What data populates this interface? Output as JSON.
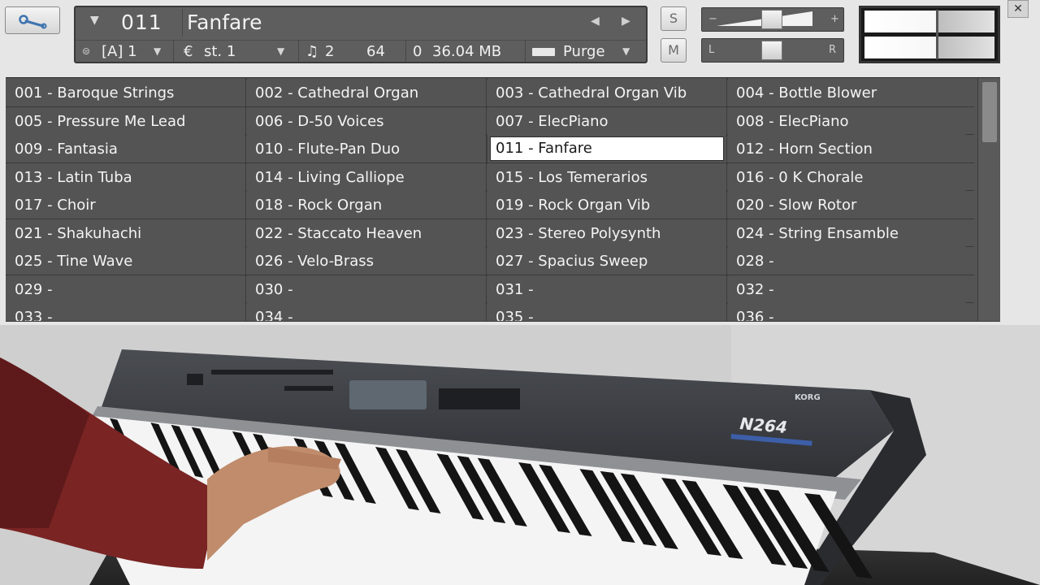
{
  "header": {
    "patch_number": "011",
    "patch_name": "Fanfare",
    "midi_channel": "[A] 1",
    "output": "st. 1",
    "voices": "2",
    "max_voices": "64",
    "memory": "36.04 MB",
    "purge_label": "Purge",
    "solo_label": "S",
    "mute_label": "M",
    "pan_left": "L",
    "pan_right": "R",
    "vol_minus": "−",
    "vol_plus": "+"
  },
  "presets": [
    "001 - Baroque Strings",
    "002 - Cathedral Organ",
    "003 - Cathedral Organ Vib",
    "004 - Bottle Blower",
    "005 - Pressure Me Lead",
    "006 - D-50 Voices",
    "007 - ElecPiano",
    "008 - ElecPiano",
    "009 - Fantasia",
    "010 - Flute-Pan Duo",
    "011 - Fanfare",
    "012 - Horn Section",
    "013 - Latin Tuba",
    "014 - Living Calliope",
    "015 - Los Temerarios",
    "016 - 0 K Chorale",
    "017 - Choir",
    "018 - Rock Organ",
    "019 - Rock Organ Vib",
    "020 - Slow Rotor",
    "021 - Shakuhachi",
    "022 - Staccato Heaven",
    "023 - Stereo Polysynth",
    "024 - String Ensamble",
    "025 - Tine Wave",
    "026 - Velo-Brass",
    "027 - Spacius Sweep",
    "028 -",
    "029 -",
    "030 -",
    "031 -",
    "032 -",
    "033 -",
    "034 -",
    "035 -",
    "036 -"
  ],
  "selected_preset": "011 - Fanfare",
  "photo": {
    "brand": "KORG",
    "model": "N264"
  },
  "icons": {
    "wrench": "wrench-icon",
    "midi": "midi-port-icon",
    "output": "output-icon",
    "voices": "voices-icon",
    "memory": "memory-icon",
    "close": "close-icon"
  },
  "colors": {
    "panel": "#5e5e5e",
    "grid_bg": "#545454",
    "selected_bg": "#ffffff",
    "chrome": "#e6e6e6"
  }
}
